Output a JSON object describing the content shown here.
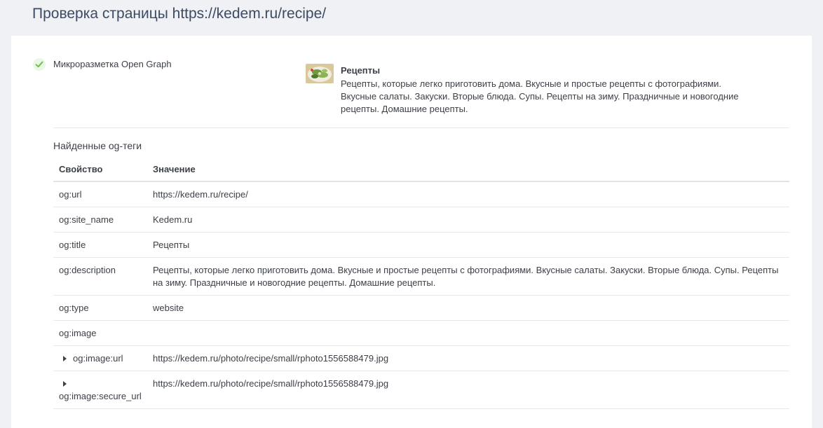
{
  "page": {
    "title": "Проверка страницы https://kedem.ru/recipe/"
  },
  "status": {
    "label": "Микроразметка Open Graph",
    "icon": "check-icon",
    "color": "#6cc24a"
  },
  "preview": {
    "title": "Рецепты",
    "description": "Рецепты, которые легко приготовить дома. Вкусные и простые рецепты с фотографиями. Вкусные салаты. Закуски. Вторые блюда. Супы. Рецепты на зиму. Праздничные и новогодние рецепты. Домашние рецепты."
  },
  "tags": {
    "section_title": "Найденные og-теги",
    "columns": {
      "property": "Свойство",
      "value": "Значение"
    },
    "rows": [
      {
        "property": "og:url",
        "value": "https://kedem.ru/recipe/"
      },
      {
        "property": "og:site_name",
        "value": "Kedem.ru"
      },
      {
        "property": "og:title",
        "value": "Рецепты"
      },
      {
        "property": "og:description",
        "value": "Рецепты, которые легко приготовить дома. Вкусные и простые рецепты с фотографиями. Вкусные салаты. Закуски. Вторые блюда. Супы. Рецепты на зиму. Праздничные и новогодние рецепты. Домашние рецепты."
      },
      {
        "property": "og:type",
        "value": "website"
      },
      {
        "property": "og:image",
        "value": ""
      },
      {
        "property": "og:image:url",
        "value": "https://kedem.ru/photo/recipe/small/rphoto1556588479.jpg"
      },
      {
        "property": "og:image:secure_url",
        "value": "https://kedem.ru/photo/recipe/small/rphoto1556588479.jpg"
      }
    ]
  }
}
